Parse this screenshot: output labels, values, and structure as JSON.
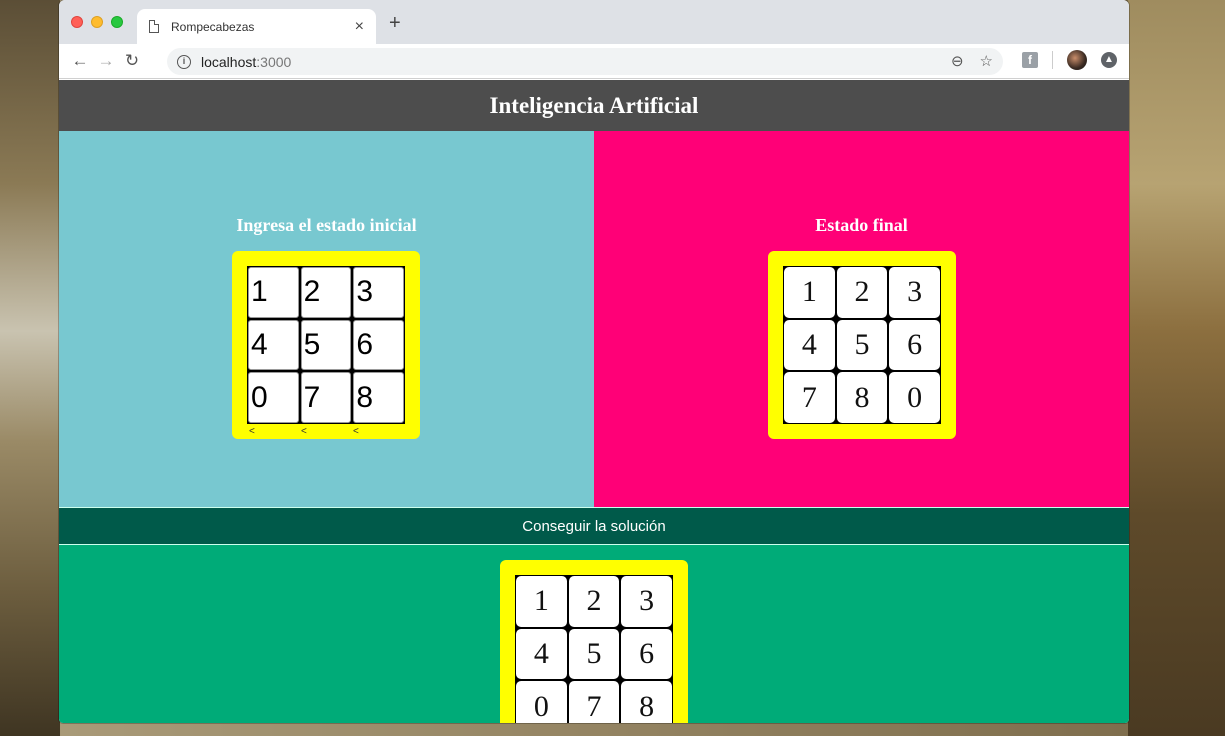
{
  "browser": {
    "tab_title": "Rompecabezas",
    "tab_close": "×",
    "new_tab": "+",
    "url_host": "localhost",
    "url_port": ":3000"
  },
  "page": {
    "header": "Inteligencia Artificial",
    "left_title": "Ingresa el estado inicial",
    "right_title": "Estado final",
    "solve_button": "Conseguir la solución"
  },
  "initial_state": [
    "1",
    "2",
    "3",
    "4",
    "5",
    "6",
    "0",
    "7",
    "8"
  ],
  "final_state": [
    "1",
    "2",
    "3",
    "4",
    "5",
    "6",
    "7",
    "8",
    "0"
  ],
  "solution_state": [
    "1",
    "2",
    "3",
    "4",
    "5",
    "6",
    "0",
    "7",
    "8"
  ],
  "arrows": [
    "<",
    "<",
    "<"
  ],
  "colors": {
    "header_bg": "#4d4d4d",
    "left_panel": "#78c8d0",
    "right_panel": "#ff0077",
    "board": "#ffff00",
    "solve_bar": "#005a4a",
    "solution_area": "#00ab78"
  }
}
